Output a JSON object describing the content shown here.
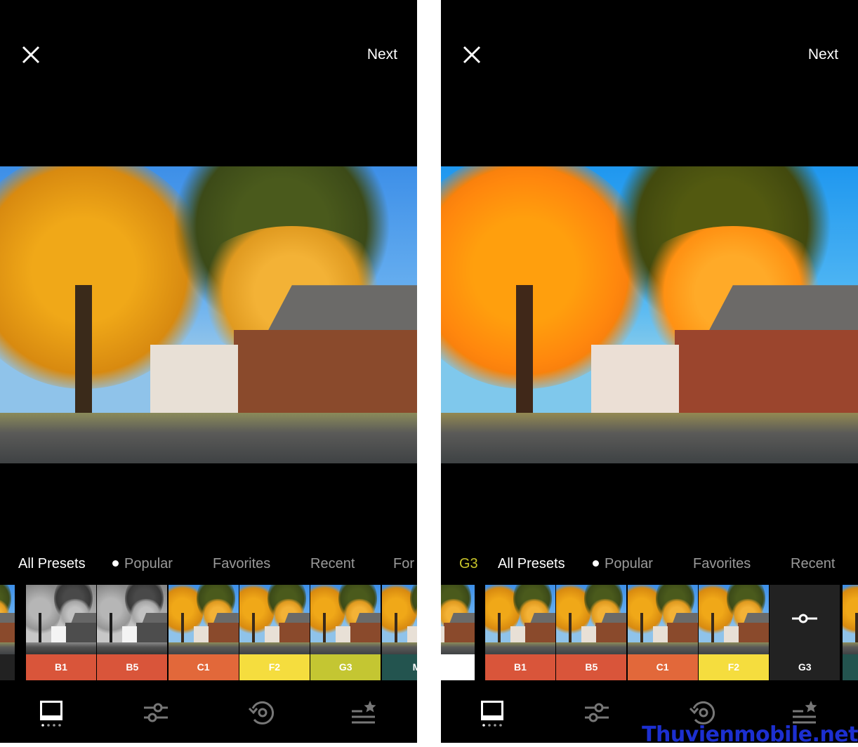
{
  "header": {
    "next_label": "Next"
  },
  "left": {
    "tabs": [
      "All Presets",
      "Popular",
      "Favorites",
      "Recent",
      "For"
    ],
    "presets": [
      {
        "label": "B1",
        "color": "#d9553a",
        "bw": true
      },
      {
        "label": "B5",
        "color": "#d9553a",
        "bw": true
      },
      {
        "label": "C1",
        "color": "#e2683a",
        "bw": false
      },
      {
        "label": "F2",
        "color": "#f5dd3e",
        "bw": false
      },
      {
        "label": "G3",
        "color": "#c4c632",
        "bw": false
      },
      {
        "label": "M",
        "color": "#23544f",
        "bw": false
      }
    ]
  },
  "right": {
    "current_preset": "G3",
    "tabs": [
      "All Presets",
      "Popular",
      "Favorites",
      "Recent"
    ],
    "presets": [
      {
        "label": "B1",
        "color": "#d9553a"
      },
      {
        "label": "B5",
        "color": "#d9553a"
      },
      {
        "label": "C1",
        "color": "#e2683a"
      },
      {
        "label": "F2",
        "color": "#f5dd3e"
      },
      {
        "label": "G3",
        "color": "#222222",
        "selected": true
      }
    ]
  },
  "bottom_nav": [
    "presets-icon",
    "adjust-sliders-icon",
    "history-icon",
    "recipes-icon"
  ],
  "watermark": "Thuvienmobile.net"
}
